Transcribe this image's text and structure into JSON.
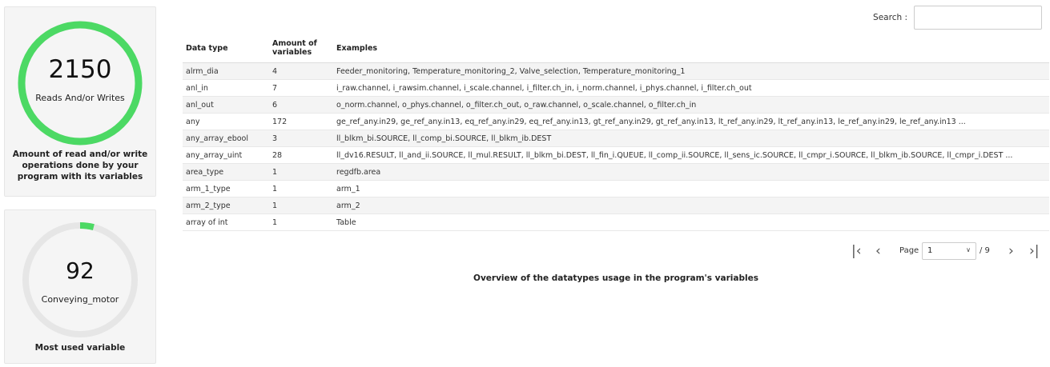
{
  "reads_card": {
    "value": "2150",
    "label": "Reads And/or Writes",
    "caption": "Amount of read and/or write operations done by your program with its variables",
    "progress": 1.0,
    "color": "#4cd964"
  },
  "variable_card": {
    "value": "92",
    "label": "Conveying_motor",
    "caption": "Most used variable",
    "progress": 0.04,
    "color": "#4cd964",
    "track_color": "#e6e6e6"
  },
  "search": {
    "label": "Search :",
    "value": ""
  },
  "table": {
    "headers": [
      "Data type",
      "Amount of variables",
      "Examples"
    ],
    "rows": [
      [
        "alrm_dia",
        "4",
        "Feeder_monitoring, Temperature_monitoring_2, Valve_selection, Temperature_monitoring_1"
      ],
      [
        "anl_in",
        "7",
        "i_raw.channel, i_rawsim.channel, i_scale.channel, i_filter.ch_in, i_norm.channel, i_phys.channel, i_filter.ch_out"
      ],
      [
        "anl_out",
        "6",
        "o_norm.channel, o_phys.channel, o_filter.ch_out, o_raw.channel, o_scale.channel, o_filter.ch_in"
      ],
      [
        "any",
        "172",
        "ge_ref_any.in29, ge_ref_any.in13, eq_ref_any.in29, eq_ref_any.in13, gt_ref_any.in29, gt_ref_any.in13, lt_ref_any.in29, lt_ref_any.in13, le_ref_any.in29, le_ref_any.in13 ..."
      ],
      [
        "any_array_ebool",
        "3",
        "ll_blkm_bi.SOURCE, ll_comp_bi.SOURCE, ll_blkm_ib.DEST"
      ],
      [
        "any_array_uint",
        "28",
        "ll_dv16.RESULT, ll_and_ii.SOURCE, ll_mul.RESULT, ll_blkm_bi.DEST, ll_fin_i.QUEUE, ll_comp_ii.SOURCE, ll_sens_ic.SOURCE, ll_cmpr_i.SOURCE, ll_blkm_ib.SOURCE, ll_cmpr_i.DEST ..."
      ],
      [
        "area_type",
        "1",
        "regdfb.area"
      ],
      [
        "arm_1_type",
        "1",
        "arm_1"
      ],
      [
        "arm_2_type",
        "1",
        "arm_2"
      ],
      [
        "array of int",
        "1",
        "Table"
      ]
    ],
    "caption": "Overview of the datatypes usage in the program's variables"
  },
  "pagination": {
    "page_label": "Page",
    "current_page": "1",
    "total": "/ 9",
    "icons": [
      "first-page-icon",
      "prev-page-icon",
      "next-page-icon",
      "last-page-icon"
    ]
  }
}
